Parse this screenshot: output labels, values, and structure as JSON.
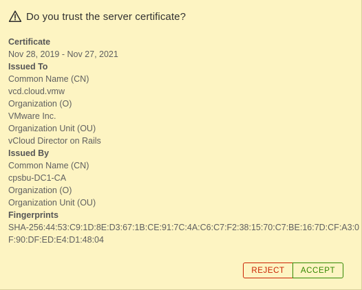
{
  "dialog": {
    "title": "Do you trust the server certificate?",
    "icon": "warning-triangle-icon"
  },
  "certificate": {
    "label": "Certificate",
    "validity": "Nov 28, 2019 - Nov 27, 2021"
  },
  "issued_to": {
    "label": "Issued To",
    "cn_label": "Common Name (CN)",
    "cn_value": "vcd.cloud.vmw",
    "o_label": "Organization (O)",
    "o_value": "VMware Inc.",
    "ou_label": "Organization Unit (OU)",
    "ou_value": "vCloud Director on Rails"
  },
  "issued_by": {
    "label": "Issued By",
    "cn_label": "Common Name (CN)",
    "cn_value": "cpsbu-DC1-CA",
    "o_label": "Organization (O)",
    "ou_label": "Organization Unit (OU)"
  },
  "fingerprints": {
    "label": "Fingerprints",
    "sha256": "SHA-256:44:53:C9:1D:8E:D3:67:1B:CE:91:7C:4A:C6:C7:F2:38:15:70:C7:BE:16:7D:CF:A3:0F:90:DF:ED:E4:D1:48:04"
  },
  "actions": {
    "reject_label": "REJECT",
    "accept_label": "ACCEPT"
  },
  "colors": {
    "background": "#fdf4c2",
    "reject": "#c92100",
    "accept": "#318700"
  }
}
